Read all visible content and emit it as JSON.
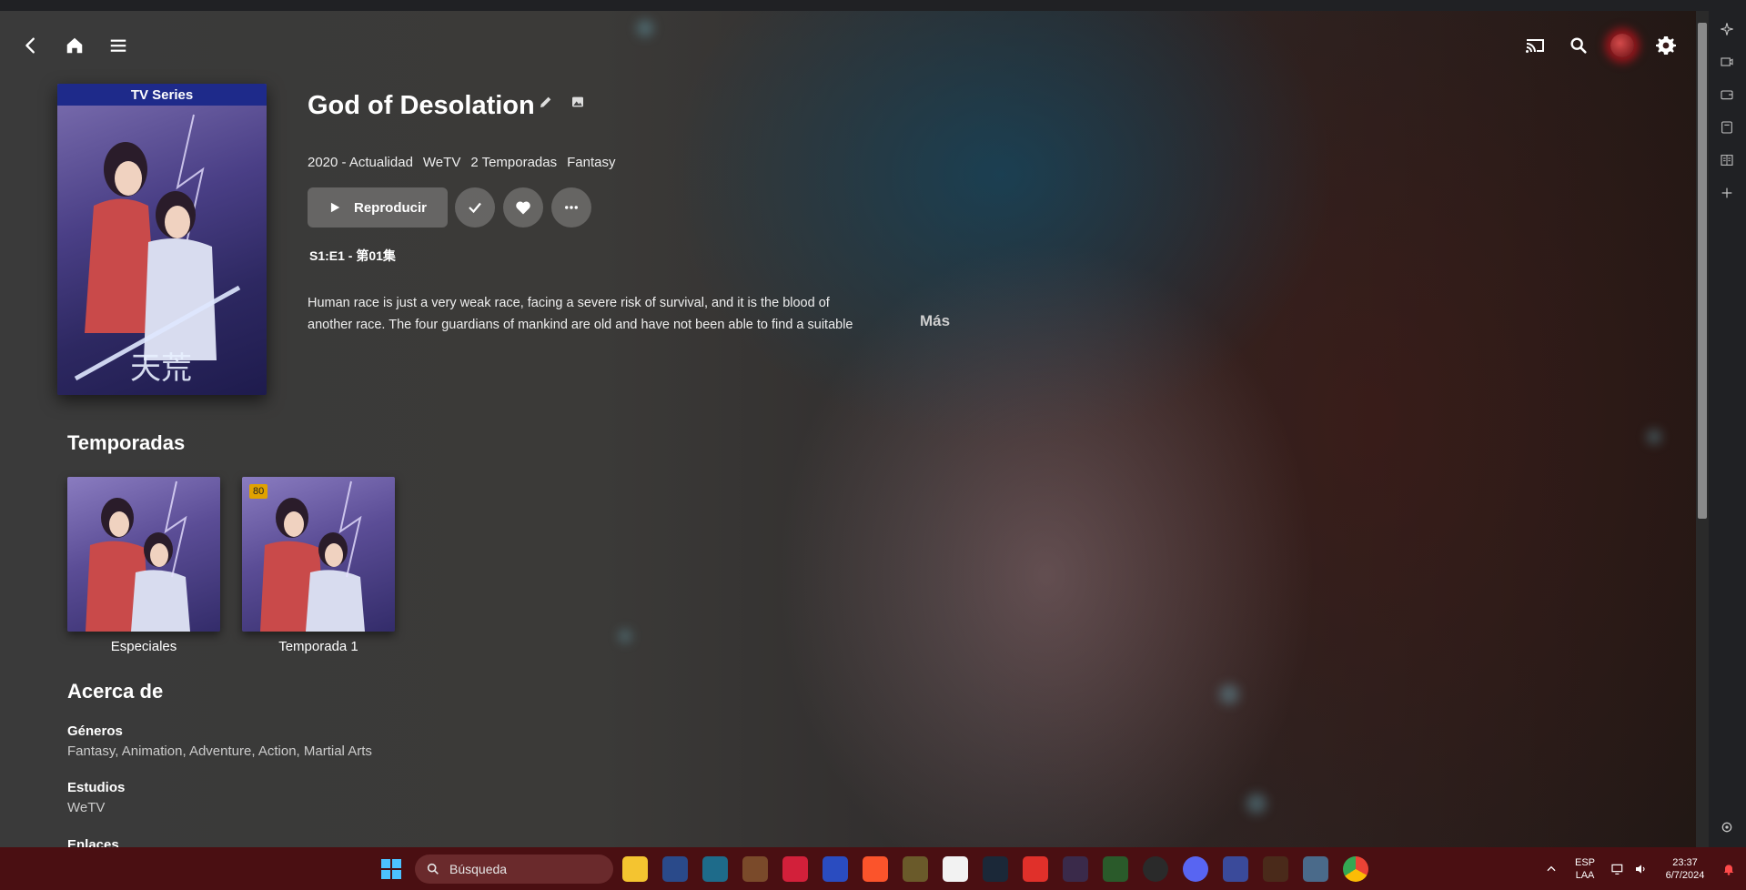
{
  "header": {
    "back_icon": "arrow-left-icon",
    "home_icon": "home-icon",
    "menu_icon": "hamburger-menu-icon",
    "cast_icon": "cast-icon",
    "search_icon": "search-icon",
    "avatar_icon": "user-avatar",
    "settings_icon": "gear-icon"
  },
  "series": {
    "poster_banner": "TV Series",
    "title": "God of Desolation",
    "edit_icon": "pencil-icon",
    "image_icon": "image-icon",
    "meta": [
      "2020 - Actualidad",
      "WeTV",
      "2 Temporadas",
      "Fantasy"
    ],
    "play_label": "Reproducir",
    "episode": "S1:E1 - 第01集",
    "description_line1": "Human race is just a very weak race, facing a severe risk of survival, and it is the blood of",
    "description_line2": "another race. The four guardians of mankind are old and have not been able to find a suitable",
    "more_label": "Más"
  },
  "seasons": {
    "title": "Temporadas",
    "items": [
      {
        "label": "Especiales",
        "badge": ""
      },
      {
        "label": "Temporada 1",
        "badge": "80"
      }
    ]
  },
  "about": {
    "title": "Acerca de",
    "genres_label": "Géneros",
    "genres_value": "Fantasy, Animation, Adventure, Action, Martial Arts",
    "studios_label": "Estudios",
    "studios_value": "WeTV",
    "links_label": "Enlaces"
  },
  "taskbar": {
    "search_placeholder": "Búsqueda",
    "lang_top": "ESP",
    "lang_bottom": "LAA",
    "time": "23:37",
    "date": "6/7/2024"
  },
  "colors": {
    "taskbar_bg": "#4a0f12",
    "badge": "#e0a200",
    "poster_banner": "#1e2a8a"
  }
}
